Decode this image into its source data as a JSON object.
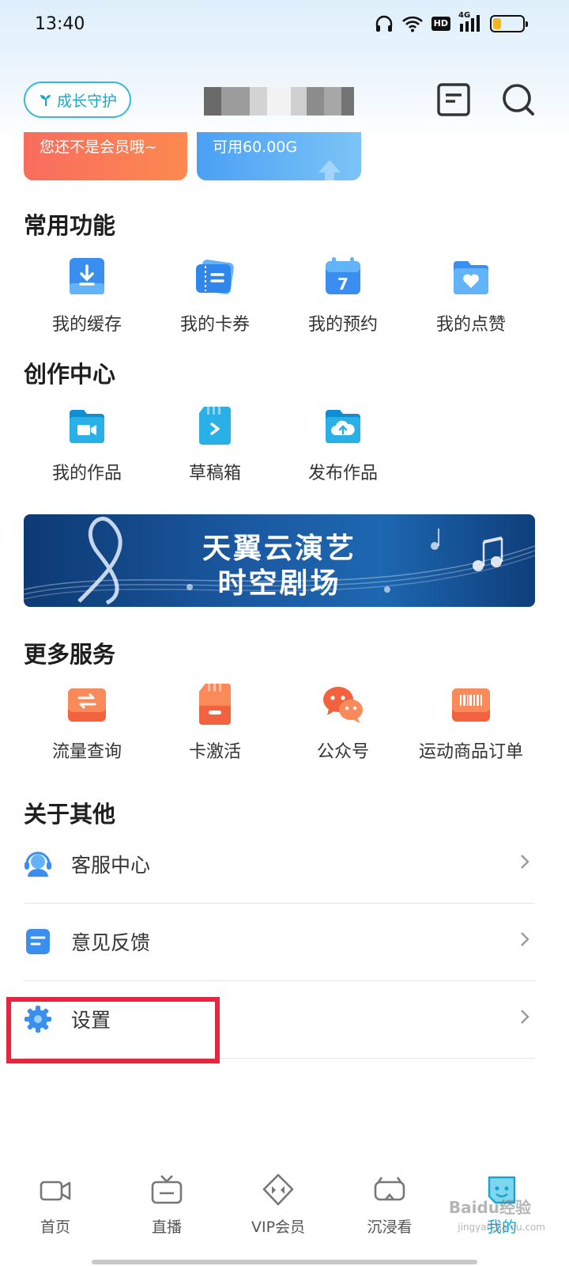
{
  "status_bar": {
    "time": "13:40",
    "hd": "HD",
    "network": "4G",
    "battery_level": 0.25
  },
  "header": {
    "growth_button": "成长守护"
  },
  "member_cards": {
    "vip_text": "您还不是会员哦~",
    "data_text": "可用60.00G"
  },
  "common_functions": {
    "title": "常用功能",
    "items": [
      {
        "label": "我的缓存",
        "icon": "download-icon"
      },
      {
        "label": "我的卡券",
        "icon": "ticket-icon"
      },
      {
        "label": "我的预约",
        "icon": "calendar-icon"
      },
      {
        "label": "我的点赞",
        "icon": "heart-folder-icon"
      }
    ]
  },
  "creation_center": {
    "title": "创作中心",
    "items": [
      {
        "label": "我的作品",
        "icon": "video-folder-icon"
      },
      {
        "label": "草稿箱",
        "icon": "draft-icon"
      },
      {
        "label": "发布作品",
        "icon": "upload-cloud-icon"
      }
    ]
  },
  "banner": {
    "line1": "天翼云演艺",
    "line2": "时空剧场"
  },
  "more_services": {
    "title": "更多服务",
    "items": [
      {
        "label": "流量查询",
        "icon": "data-flow-icon"
      },
      {
        "label": "卡激活",
        "icon": "sim-card-icon"
      },
      {
        "label": "公众号",
        "icon": "wechat-icon"
      },
      {
        "label": "运动商品订单",
        "icon": "barcode-icon"
      }
    ]
  },
  "about": {
    "title": "关于其他",
    "items": [
      {
        "label": "客服中心",
        "icon": "customer-service-icon"
      },
      {
        "label": "意见反馈",
        "icon": "feedback-icon"
      },
      {
        "label": "设置",
        "icon": "gear-icon"
      }
    ]
  },
  "bottom_nav": {
    "items": [
      {
        "label": "首页",
        "icon": "camera-icon"
      },
      {
        "label": "直播",
        "icon": "tv-icon"
      },
      {
        "label": "VIP会员",
        "icon": "diamond-icon"
      },
      {
        "label": "沉浸看",
        "icon": "vr-icon"
      },
      {
        "label": "我的",
        "icon": "profile-icon"
      }
    ],
    "active_index": 4
  },
  "watermark": {
    "text": "Baidu经验",
    "sub": "jingyan.baidu.com"
  },
  "colors": {
    "accent": "#1aa6cc",
    "highlight": "#e8253f",
    "vip": "#f86c5e",
    "data": "#4aa0f5"
  }
}
